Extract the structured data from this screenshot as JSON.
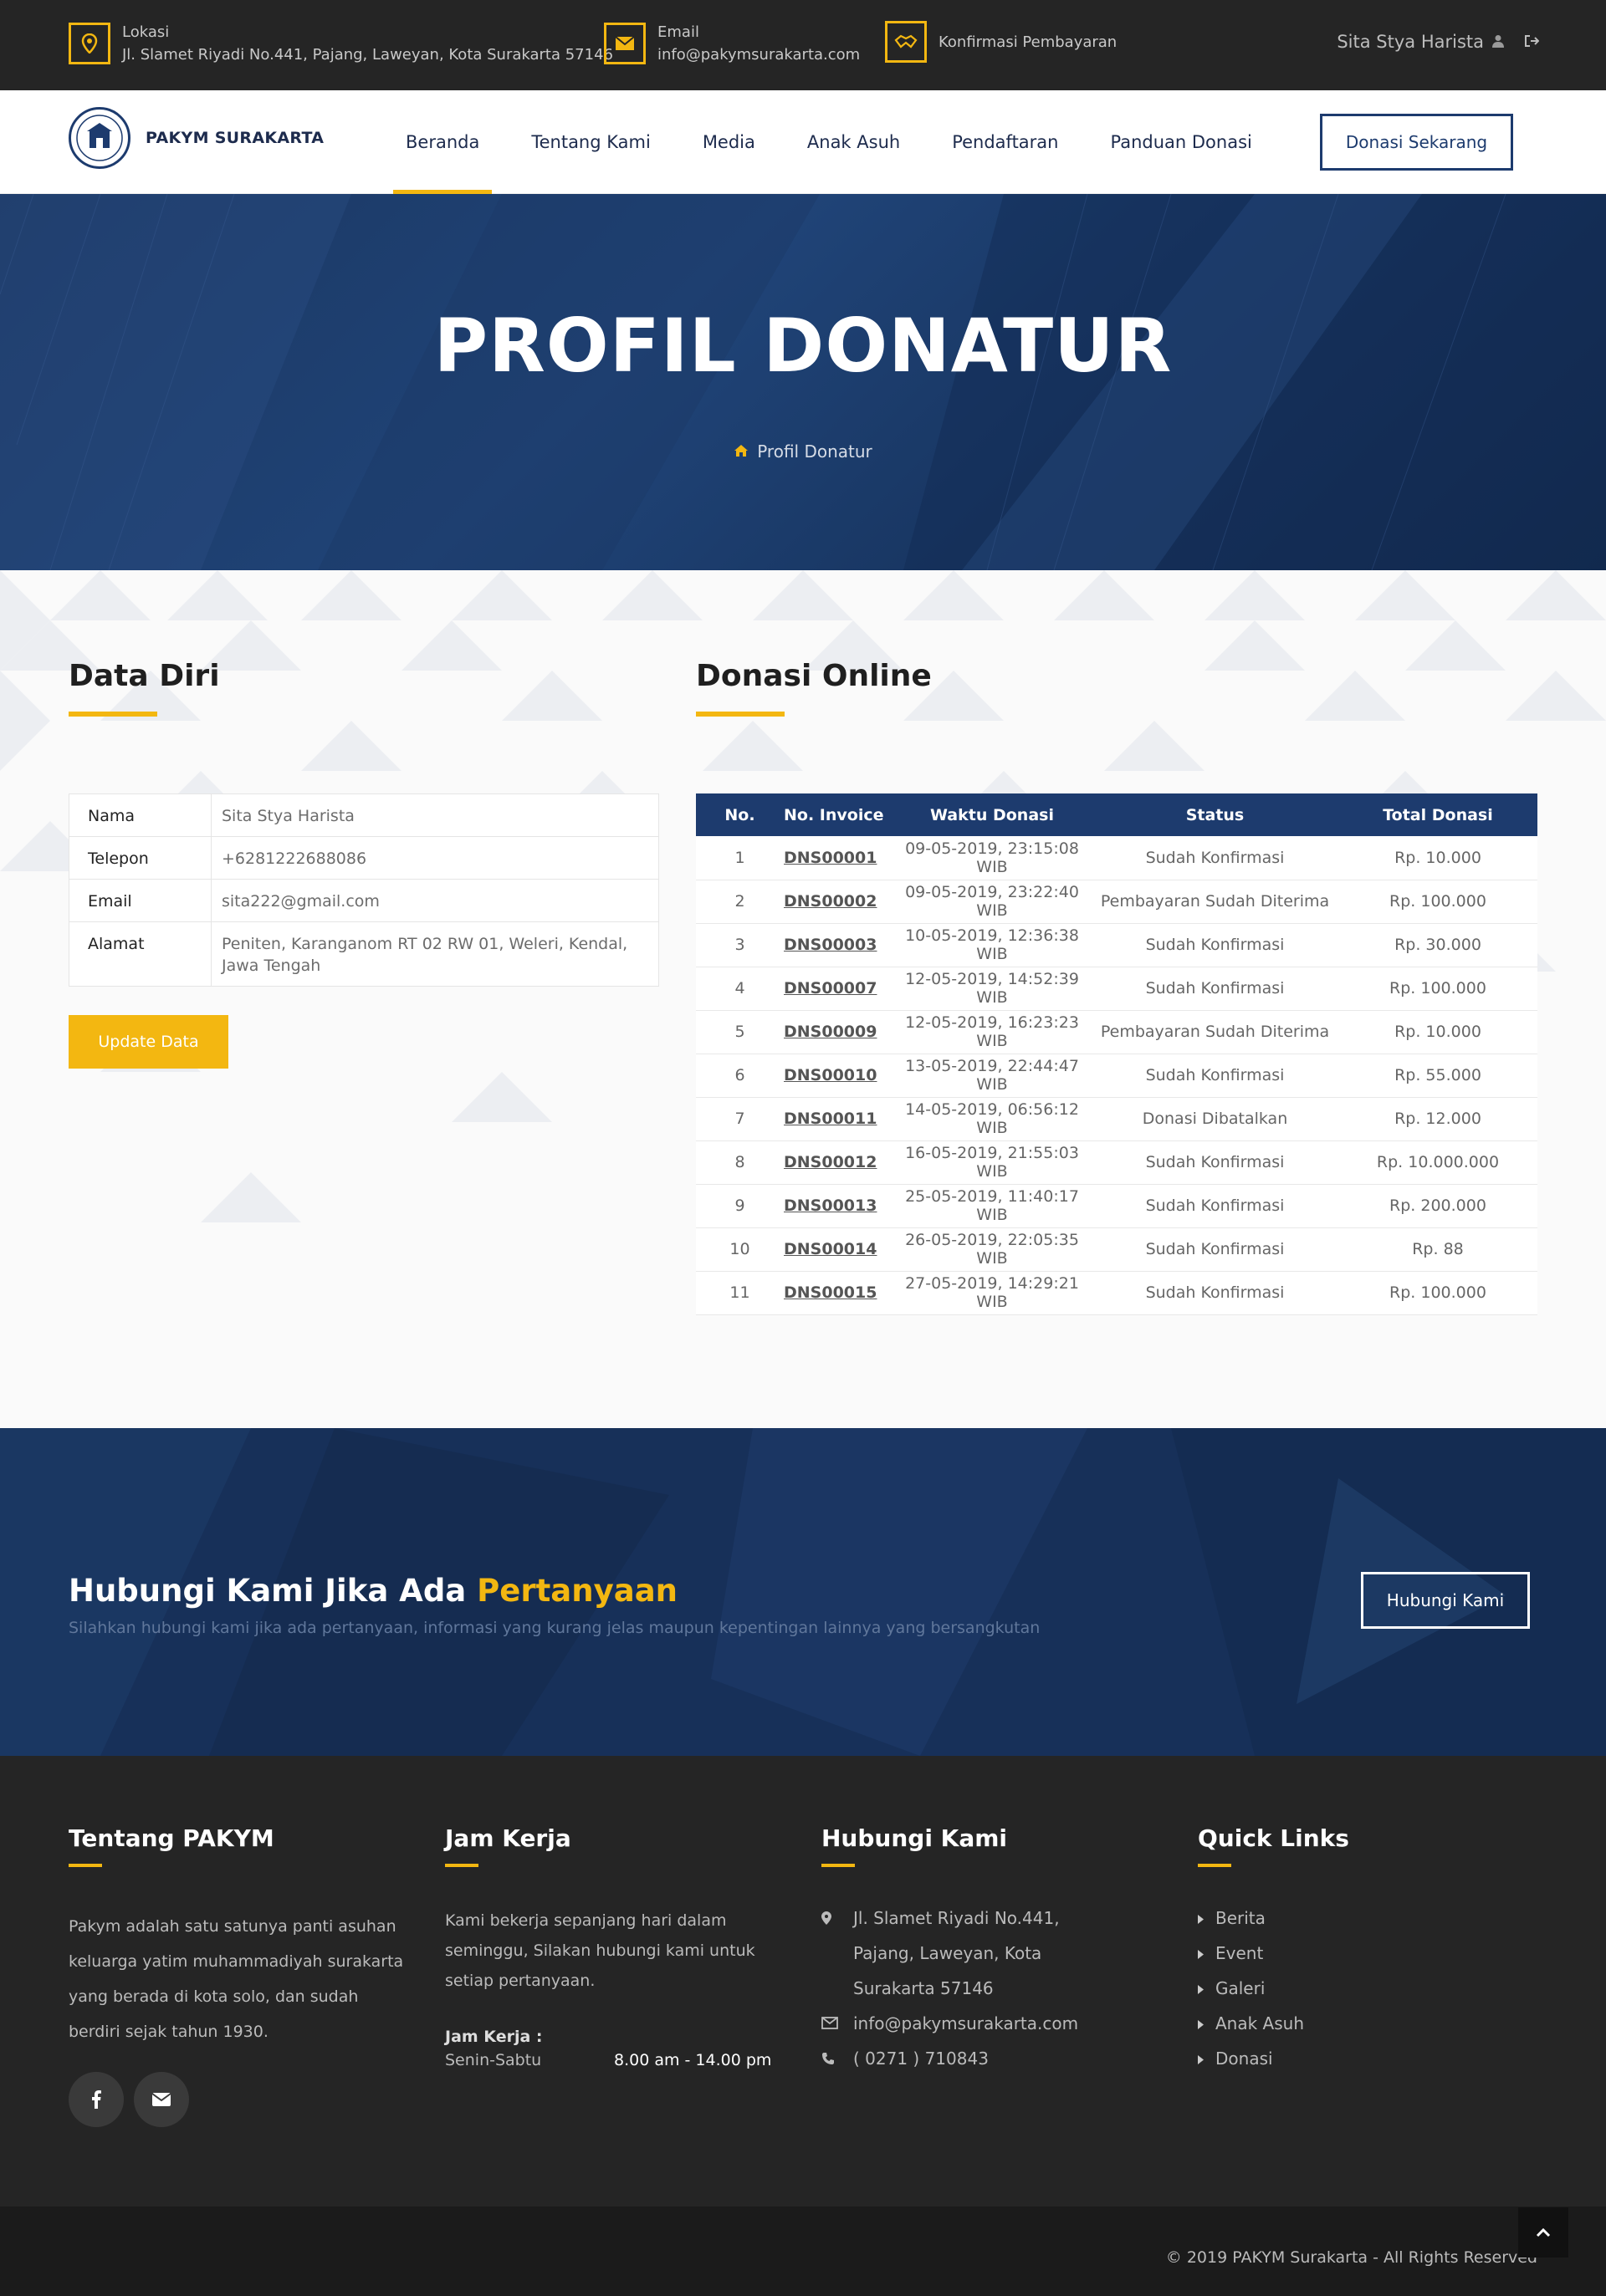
{
  "topbar": {
    "location_label": "Lokasi",
    "location_value": "Jl. Slamet Riyadi No.441, Pajang, Laweyan, Kota Surakarta 57146",
    "email_label": "Email",
    "email_value": "info@pakymsurakarta.com",
    "confirm_label": "Konfirmasi Pembayaran",
    "user_name": "Sita Stya Harista"
  },
  "nav": {
    "brand": "PAKYM SURAKARTA",
    "items": [
      "Beranda",
      "Tentang Kami",
      "Media",
      "Anak Asuh",
      "Pendaftaran",
      "Panduan Donasi"
    ],
    "active": "Beranda",
    "cta": "Donasi Sekarang"
  },
  "hero": {
    "title": "PROFIL DONATUR",
    "breadcrumb": "Profil Donatur"
  },
  "profile": {
    "title": "Data Diri",
    "rows": [
      {
        "label": "Nama",
        "value": "Sita Stya Harista"
      },
      {
        "label": "Telepon",
        "value": "+6281222688086"
      },
      {
        "label": "Email",
        "value": "sita222@gmail.com"
      },
      {
        "label": "Alamat",
        "value": "Peniten, Karanganom RT 02 RW 01, Weleri, Kendal, Jawa Tengah"
      }
    ],
    "update_button": "Update Data"
  },
  "donations": {
    "title": "Donasi Online",
    "headers": [
      "No.",
      "No. Invoice",
      "Waktu Donasi",
      "Status",
      "Total Donasi"
    ],
    "rows": [
      [
        "1",
        "DNS00001",
        "09-05-2019, 23:15:08 WIB",
        "Sudah Konfirmasi",
        "Rp. 10.000"
      ],
      [
        "2",
        "DNS00002",
        "09-05-2019, 23:22:40 WIB",
        "Pembayaran Sudah Diterima",
        "Rp. 100.000"
      ],
      [
        "3",
        "DNS00003",
        "10-05-2019, 12:36:38 WIB",
        "Sudah Konfirmasi",
        "Rp. 30.000"
      ],
      [
        "4",
        "DNS00007",
        "12-05-2019, 14:52:39 WIB",
        "Sudah Konfirmasi",
        "Rp. 100.000"
      ],
      [
        "5",
        "DNS00009",
        "12-05-2019, 16:23:23 WIB",
        "Pembayaran Sudah Diterima",
        "Rp. 10.000"
      ],
      [
        "6",
        "DNS00010",
        "13-05-2019, 22:44:47 WIB",
        "Sudah Konfirmasi",
        "Rp. 55.000"
      ],
      [
        "7",
        "DNS00011",
        "14-05-2019, 06:56:12 WIB",
        "Donasi Dibatalkan",
        "Rp. 12.000"
      ],
      [
        "8",
        "DNS00012",
        "16-05-2019, 21:55:03 WIB",
        "Sudah Konfirmasi",
        "Rp. 10.000.000"
      ],
      [
        "9",
        "DNS00013",
        "25-05-2019, 11:40:17 WIB",
        "Sudah Konfirmasi",
        "Rp. 200.000"
      ],
      [
        "10",
        "DNS00014",
        "26-05-2019, 22:05:35 WIB",
        "Sudah Konfirmasi",
        "Rp. 88"
      ],
      [
        "11",
        "DNS00015",
        "27-05-2019, 14:29:21 WIB",
        "Sudah Konfirmasi",
        "Rp. 100.000"
      ]
    ]
  },
  "cta": {
    "title_main": "Hubungi Kami Jika Ada ",
    "title_accent": "Pertanyaan",
    "subtitle": "Silahkan hubungi kami jika ada pertanyaan, informasi yang kurang jelas maupun kepentingan lainnya yang bersangkutan",
    "button": "Hubungi Kami"
  },
  "footer": {
    "about_title": "Tentang PAKYM",
    "about_text": "Pakym adalah satu satunya panti asuhan keluarga yatim muhammadiyah surakarta yang berada di kota solo, dan sudah berdiri sejak tahun 1930.",
    "hours_title": "Jam Kerja",
    "hours_text": "Kami bekerja sepanjang hari dalam seminggu, Silakan hubungi kami untuk setiap pertanyaan.",
    "hours_label": "Jam Kerja :",
    "hours_days": "Senin-Sabtu",
    "hours_time": "8.00 am - 14.00 pm",
    "contact_title": "Hubungi Kami",
    "contact_address": "Jl. Slamet Riyadi No.441, Pajang, Laweyan, Kota Surakarta 57146",
    "contact_email": "info@pakymsurakarta.com",
    "contact_phone": "( 0271 ) 710843",
    "links_title": "Quick Links",
    "links": [
      "Berita",
      "Event",
      "Galeri",
      "Anak Asuh",
      "Donasi"
    ],
    "copyright": "© 2019 PAKYM Surakarta - All Rights Reserved"
  },
  "colors": {
    "accent": "#f3b711",
    "navy": "#1d3b6e",
    "dark": "#252525"
  }
}
